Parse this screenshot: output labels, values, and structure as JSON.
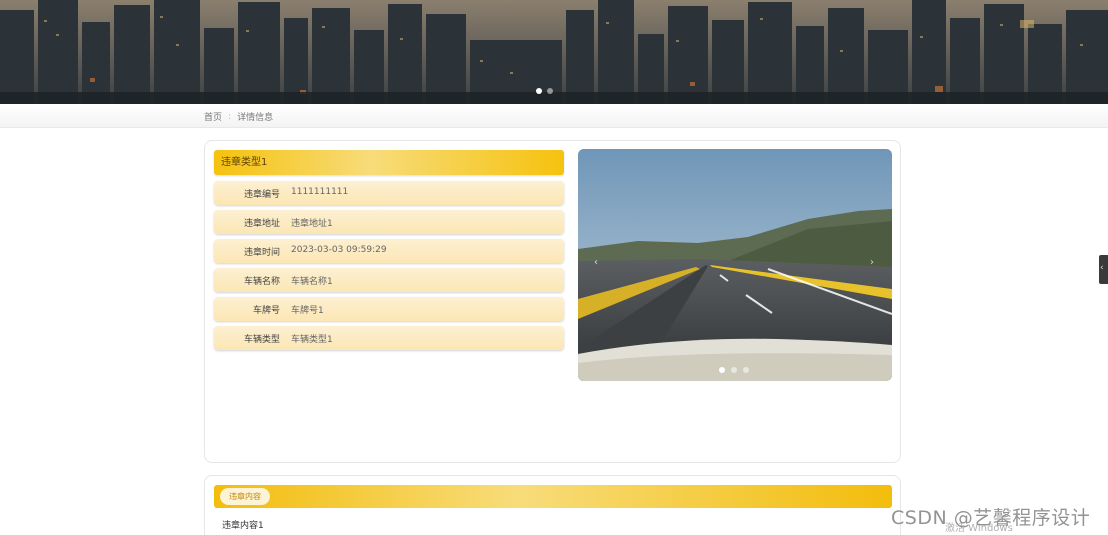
{
  "breadcrumb": {
    "home": "首页",
    "separator": ":",
    "current": "详情信息"
  },
  "detail": {
    "title": "违章类型1",
    "fields": [
      {
        "label": "违章编号",
        "value": "1111111111"
      },
      {
        "label": "违章地址",
        "value": "违章地址1"
      },
      {
        "label": "违章时间",
        "value": "2023-03-03 09:59:29"
      },
      {
        "label": "车辆名称",
        "value": "车辆名称1"
      },
      {
        "label": "车牌号",
        "value": "车牌号1"
      },
      {
        "label": "车辆类型",
        "value": "车辆类型1"
      }
    ]
  },
  "slider": {
    "prev_label": "‹",
    "next_label": "›",
    "slide_count": 3,
    "active_index": 0
  },
  "banner": {
    "slide_count": 2,
    "active_index": 0
  },
  "content": {
    "tab_label": "违章内容",
    "text": "违章内容1"
  },
  "side_handle": {
    "label": "‹"
  },
  "overlays": {
    "watermark": "CSDN @艺馨程序设计",
    "activate_windows": "激活 Windows"
  },
  "colors": {
    "accent": "#f5c20e",
    "row_background": "#fbe6b4"
  }
}
